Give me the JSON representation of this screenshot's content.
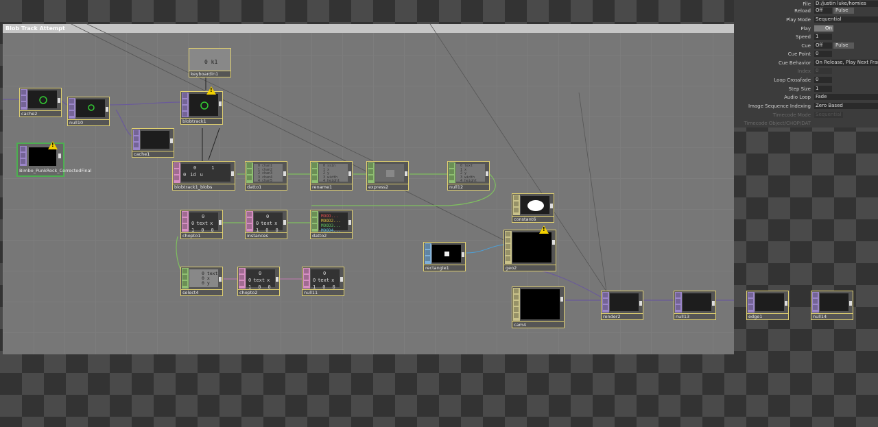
{
  "network": {
    "title": "Blob Track Attempt"
  },
  "nodes": [
    {
      "id": "cache2",
      "label": "cache2"
    },
    {
      "id": "null10",
      "label": "null10"
    },
    {
      "id": "keyboardin1",
      "label": "keyboardin1",
      "value": "0 k1"
    },
    {
      "id": "blobtrack1",
      "label": "blobtrack1"
    },
    {
      "id": "cache1",
      "label": "cache1"
    },
    {
      "id": "bimbo",
      "label": "Bimbo_PunkRock_CorrectedFinal"
    },
    {
      "id": "blobtrack1_blobs",
      "label": "blobtrack1_blobs",
      "header": [
        "0",
        "1"
      ],
      "row": [
        "0",
        "id",
        "u"
      ]
    },
    {
      "id": "datto1",
      "label": "datto1",
      "lines": [
        "0 chan1",
        "1 chan2",
        "2 chan3",
        "3 chan4",
        "4 chan5"
      ]
    },
    {
      "id": "rename1",
      "label": "rename1",
      "lines": [
        "0 ssin",
        "1 x",
        "2 y",
        "3 width",
        "4 height"
      ]
    },
    {
      "id": "express2",
      "label": "express2"
    },
    {
      "id": "null12",
      "label": "null12",
      "lines": [
        "0 text",
        "1 x",
        "2 y",
        "3 width",
        "4 height"
      ]
    },
    {
      "id": "constant6",
      "label": "constant6"
    },
    {
      "id": "chopto1",
      "label": "chopto1",
      "header": [
        "0"
      ],
      "row": [
        "0",
        "text",
        "x"
      ],
      "row2": [
        "1",
        "0",
        "0"
      ]
    },
    {
      "id": "instances",
      "label": "instances",
      "header": [
        "0"
      ],
      "row": [
        "0",
        "text",
        "x"
      ],
      "row2": [
        "1",
        "0",
        "0"
      ]
    },
    {
      "id": "datto2",
      "label": "datto2",
      "lines": [
        "MOOD...",
        "MOOD2...",
        "MOOD3...",
        "MOOD4..."
      ]
    },
    {
      "id": "rectangle1",
      "label": "rectangle1"
    },
    {
      "id": "geo2",
      "label": "geo2"
    },
    {
      "id": "select4",
      "label": "select4",
      "lines": [
        "0 text",
        "0 x",
        "0 y"
      ]
    },
    {
      "id": "chopto2",
      "label": "chopto2",
      "header": [
        "0"
      ],
      "row": [
        "0",
        "text",
        "x"
      ],
      "row2": [
        "1",
        "0",
        "0"
      ]
    },
    {
      "id": "null11",
      "label": "null11",
      "header": [
        "0"
      ],
      "row": [
        "0",
        "text",
        "x"
      ],
      "row2": [
        "1",
        "0",
        "0"
      ]
    },
    {
      "id": "cam4",
      "label": "cam4"
    },
    {
      "id": "render2",
      "label": "render2"
    },
    {
      "id": "null13",
      "label": "null13"
    },
    {
      "id": "edge1",
      "label": "edge1"
    },
    {
      "id": "null14",
      "label": "null14"
    }
  ],
  "params": {
    "rows": [
      {
        "label": "File",
        "value": "D:/justin luke/homies"
      },
      {
        "label": "Reload",
        "value": "Off",
        "button": "Pulse"
      },
      {
        "label": "Play Mode",
        "value": "Sequential"
      },
      {
        "label": "Play",
        "value": "On"
      },
      {
        "label": "Speed",
        "value": "1"
      },
      {
        "label": "Cue",
        "value": "Off",
        "button": "Pulse"
      },
      {
        "label": "Cue Point",
        "value": "0"
      },
      {
        "label": "Cue Behavior",
        "value": "On Release, Play Next Frame"
      },
      {
        "label": "Index",
        "value": "0",
        "disabled": true
      },
      {
        "label": "Loop Crossfade",
        "value": "0"
      },
      {
        "label": "Step Size",
        "value": "1"
      },
      {
        "label": "Audio Loop",
        "value": "Fade"
      },
      {
        "label": "Image Sequence Indexing",
        "value": "Zero Based"
      },
      {
        "label": "Timecode Mode",
        "value": "Sequential",
        "disabled": true
      },
      {
        "label": "Timecode Object/CHOP/DAT",
        "value": "",
        "disabled": true
      }
    ]
  },
  "colors": {
    "top": "#9b86c9",
    "chop": "#8fbf72",
    "dat": "#d68fc2",
    "sop": "#80b0d8",
    "comp": "#c9c28a",
    "selected": "#4caf50",
    "warning": "#f2d000"
  }
}
